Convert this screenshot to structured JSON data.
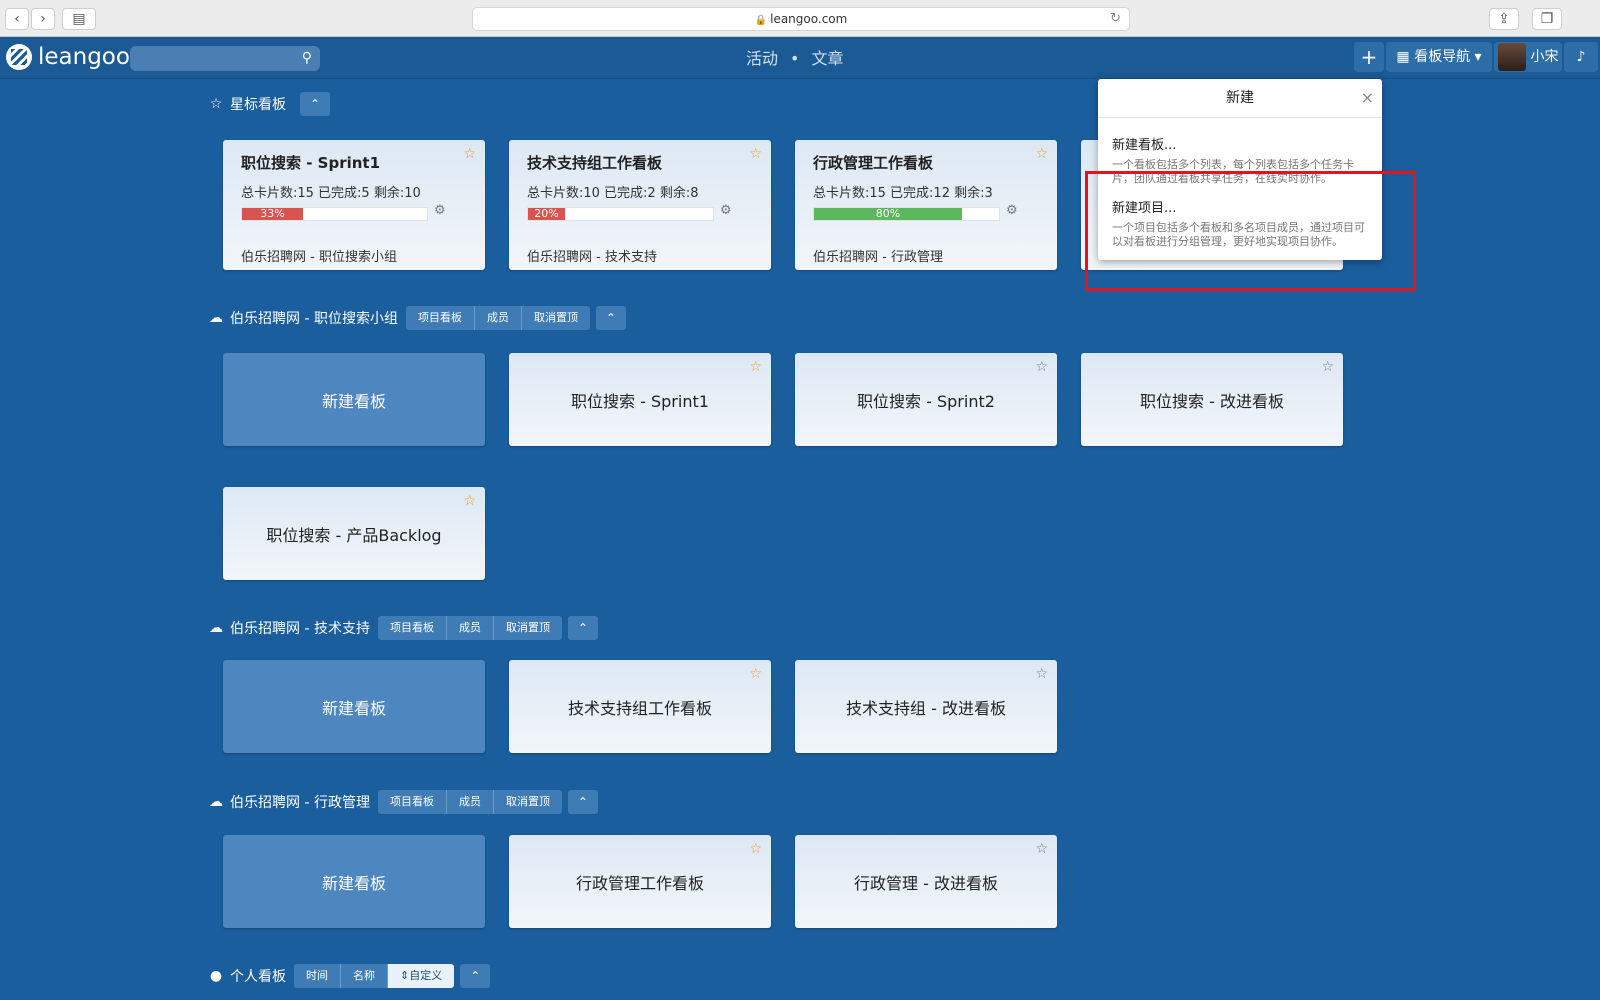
{
  "browser": {
    "url": "leangoo.com"
  },
  "header": {
    "logo": "leangoo",
    "nav_activity": "活动",
    "nav_sep": "•",
    "nav_articles": "文章",
    "add": "+",
    "board_nav": "看板导航",
    "user": "小宋"
  },
  "starred": {
    "title": "星标看板",
    "cards": [
      {
        "title": "职位搜索 - Sprint1",
        "summary": "总卡片数:15  已完成:5  剩余:10",
        "percent": "33%",
        "progress": 33,
        "color": "#d9534f",
        "project": "伯乐招聘网 - 职位搜索小组"
      },
      {
        "title": "技术支持组工作看板",
        "summary": "总卡片数:10  已完成:2  剩余:8",
        "percent": "20%",
        "progress": 20,
        "color": "#d9534f",
        "project": "伯乐招聘网 - 技术支持"
      },
      {
        "title": "行政管理工作看板",
        "summary": "总卡片数:15  已完成:12  剩余:3",
        "percent": "80%",
        "progress": 80,
        "color": "#5cb85c",
        "project": "伯乐招聘网 - 行政管理"
      }
    ]
  },
  "project_buttons": {
    "boards": "项目看板",
    "members": "成员",
    "unpin": "取消置顶"
  },
  "projects": [
    {
      "title": "伯乐招聘网 - 职位搜索小组",
      "new_board": "新建看板",
      "boards": [
        "职位搜索 - Sprint1",
        "职位搜索 - Sprint2",
        "职位搜索 - 改进看板",
        "职位搜索 - 产品Backlog"
      ]
    },
    {
      "title": "伯乐招聘网 - 技术支持",
      "new_board": "新建看板",
      "boards": [
        "技术支持组工作看板",
        "技术支持组 - 改进看板"
      ]
    },
    {
      "title": "伯乐招聘网 - 行政管理",
      "new_board": "新建看板",
      "boards": [
        "行政管理工作看板",
        "行政管理 - 改进看板"
      ]
    }
  ],
  "personal": {
    "title": "个人看板",
    "sort_time": "时间",
    "sort_name": "名称",
    "sort_custom": "⇕自定义"
  },
  "popover": {
    "title": "新建",
    "item1_title": "新建看板...",
    "item1_desc": "一个看板包括多个列表，每个列表包括多个任务卡片，团队通过看板共享任务，在线实时协作。",
    "item2_title": "新建项目...",
    "item2_desc": "一个项目包括多个看板和多名项目成员，通过项目可以对看板进行分组管理，更好地实现项目协作。"
  }
}
